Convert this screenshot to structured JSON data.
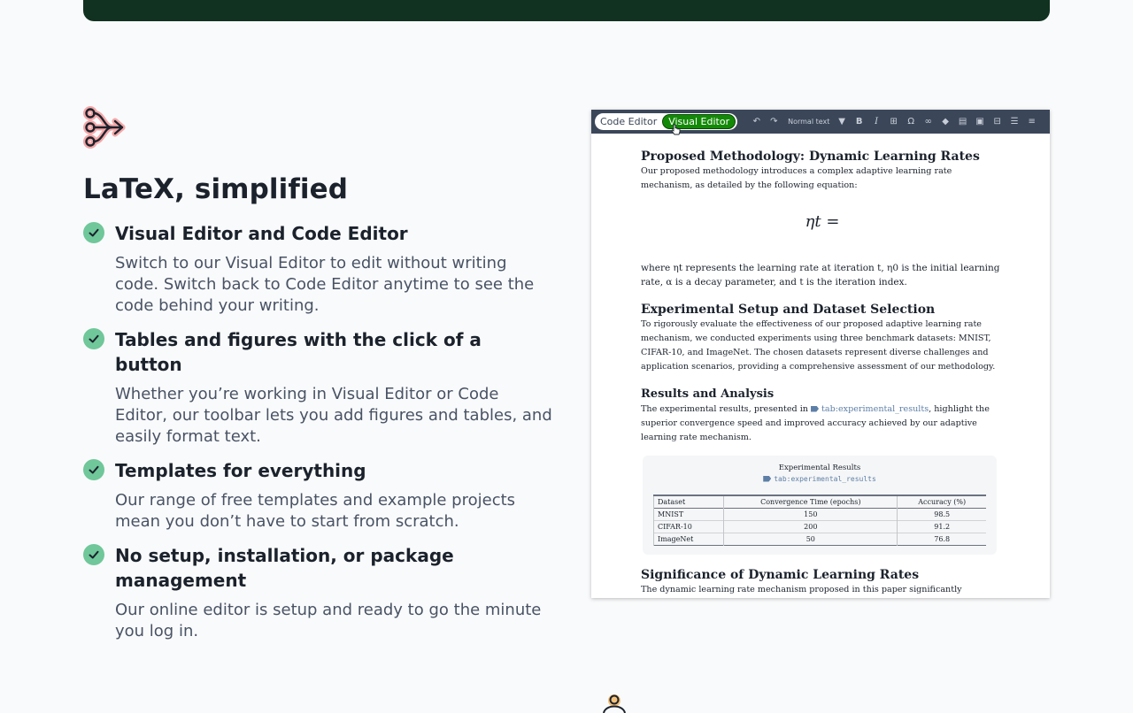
{
  "heading": "LaTeX, simplified",
  "features": [
    {
      "title": "Visual Editor and Code Editor",
      "desc": "Switch to our Visual Editor to edit without writing code. Switch back to Code Editor anytime to see the code behind your writing."
    },
    {
      "title": "Tables and figures with the click of a button",
      "desc": "Whether you’re working in Visual Editor or Code Editor, our toolbar lets you add figures and tables, and easily format text."
    },
    {
      "title": "Templates for everything",
      "desc": "Our range of free templates and example projects mean you don’t have to start from scratch."
    },
    {
      "title": "No setup, installation, or package management",
      "desc": "Our online editor is setup and ready to go the minute you log in."
    }
  ],
  "editor": {
    "code_editor_label": "Code Editor",
    "visual_editor_label": "Visual Editor",
    "text_style": "Normal text",
    "toolbar_icons": [
      "undo-icon",
      "redo-icon",
      "dropdown-arrow-icon",
      "bold-icon",
      "italic-icon",
      "math-icon",
      "omega-icon",
      "link-icon",
      "tag-icon",
      "reference-icon",
      "image-icon",
      "table-icon",
      "bullet-list-icon",
      "numbered-list-icon"
    ]
  },
  "document": {
    "h1": "Proposed Methodology: Dynamic Learning Rates",
    "p1": "Our proposed methodology introduces a complex adaptive learning rate mechanism, as detailed by the following equation:",
    "equation": "ηt =",
    "p2": "where ηt represents the learning rate at iteration t, η0 is the initial learning rate, α is a decay parameter, and t is the iteration index.",
    "h2": "Experimental Setup and Dataset Selection",
    "p3": "To rigorously evaluate the effectiveness of our proposed adaptive learning rate mechanism, we conducted experiments using three benchmark datasets: MNIST, CIFAR-10, and ImageNet. The chosen datasets represent diverse challenges and application scenarios, providing a comprehensive assessment of our methodology.",
    "h3": "Results and Analysis",
    "p4_before": "The experimental results, presented in ",
    "p4_ref": "tab:experimental_results",
    "p4_after": ", highlight the superior convergence speed and improved accuracy achieved by our adaptive learning rate mechanism.",
    "table_caption": "Experimental Results",
    "table_label": "tab:experimental_results",
    "table_headers": [
      "Dataset",
      "Convergence Time (epochs)",
      "Accuracy (%)"
    ],
    "table_rows": [
      [
        "MNIST",
        "150",
        "98.5"
      ],
      [
        "CIFAR-10",
        "200",
        "91.2"
      ],
      [
        "ImageNet",
        "50",
        "76.8"
      ]
    ],
    "h4": "Significance of Dynamic Learning Rates",
    "p5": "The dynamic learning rate mechanism proposed in this paper significantly enhances"
  },
  "colors": {
    "brand_dark": "#113221",
    "accent_green": "#138a07",
    "check_green": "#6fc79a",
    "toolbar": "#3b4759"
  }
}
